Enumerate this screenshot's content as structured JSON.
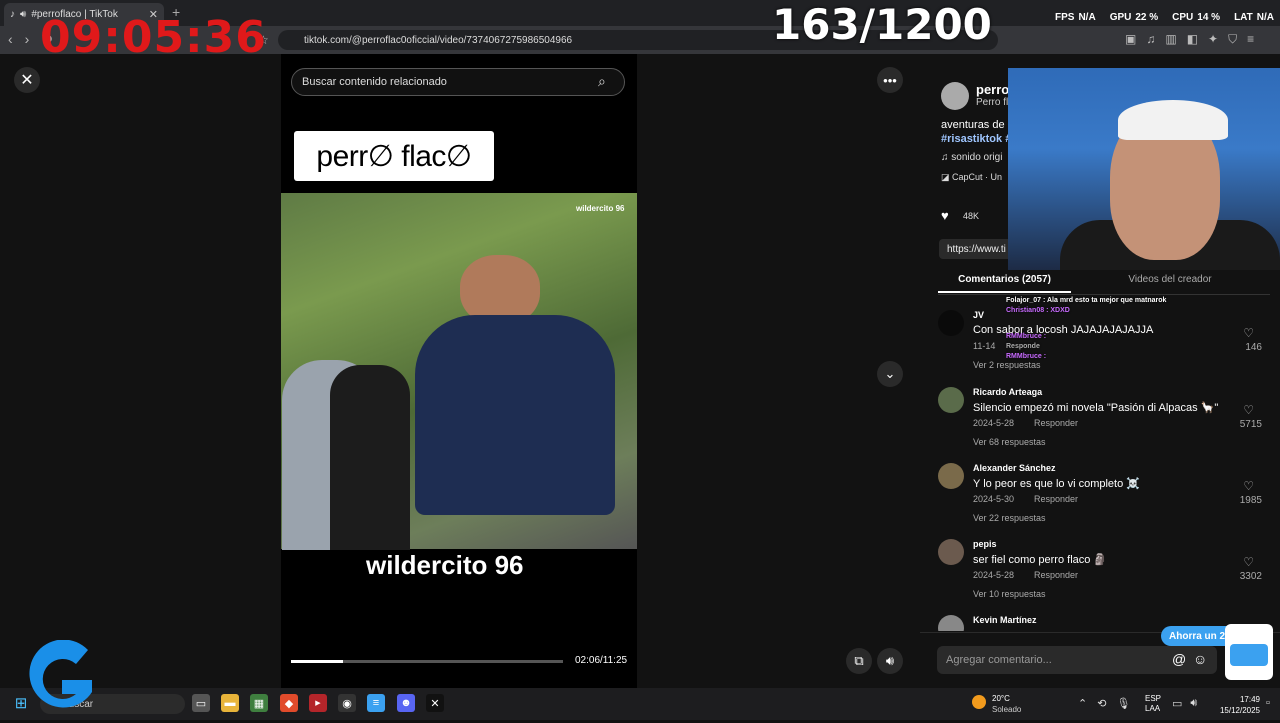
{
  "browser": {
    "tab_title": "#perroflaco | TikTok",
    "tab_close": "✕",
    "new_tab": "+",
    "url": "tiktok.com/@perroflac0oficcial/video/7374067275986504966"
  },
  "overlay": {
    "clock": "09:05:36",
    "counter": "163/1200",
    "fps_label": "FPS",
    "fps_value": "N/A",
    "gpu_label": "GPU",
    "gpu_value": "22 %",
    "cpu_label": "CPU",
    "cpu_value": "14 %",
    "lat_label": "LAT",
    "lat_value": "N/A"
  },
  "video": {
    "search_placeholder": "Buscar contenido relacionado",
    "logo_text": "perr∅ flac∅",
    "watermark": "wildercito 96",
    "caption": "wildercito 96",
    "time": "02:06/11:25",
    "progress": 0.19
  },
  "panel": {
    "author": "perro",
    "author_sub": "Perro fl",
    "desc": "aventuras de",
    "hashtag": "#risastiktok #",
    "sound": "sonido origi",
    "capcut": "CapCut · Un",
    "likes": "48K",
    "link": "https://www.ti",
    "tab_comments": "Comentarios (2057)",
    "tab_videos": "Videos del creador",
    "chat_lines": [
      "Folajor_07 : Ala mrd esto ta mejor que matnarok",
      "Christian08 : XDXD",
      "RMMbruce :",
      "Responde",
      "RMMbruce :"
    ]
  },
  "comments": [
    {
      "user": "JV",
      "text": "Con sabor a locosh JAJAJAJAJAJJA",
      "date": "11-14",
      "reply": "",
      "replies": "Ver 2 respuestas",
      "likes": "146"
    },
    {
      "user": "Ricardo Arteaga",
      "text": "Silencio empezó mi novela \"Pasión di Alpacas 🦙\"",
      "date": "2024-5-28",
      "reply": "Responder",
      "replies": "Ver 68 respuestas",
      "likes": "5715"
    },
    {
      "user": "Alexander Sánchez",
      "text": "Y lo peor es que lo vi completo ☠️",
      "date": "2024-5-30",
      "reply": "Responder",
      "replies": "Ver 22 respuestas",
      "likes": "1985"
    },
    {
      "user": "pepis",
      "text": "ser fiel como perro flaco 🗿",
      "date": "2024-5-28",
      "reply": "Responder",
      "replies": "Ver 10 respuestas",
      "likes": "3302"
    },
    {
      "user": "Kevin Martínez",
      "text": "",
      "date": "",
      "reply": "",
      "replies": "",
      "likes": ""
    }
  ],
  "comment_input_placeholder": "Agregar comentario...",
  "popup": "Ahorra un 2",
  "taskbar": {
    "search": "Buscar",
    "weather_temp": "20°C",
    "weather_desc": "Soleado",
    "lang1": "ESP",
    "lang2": "LAA",
    "time": "17:49",
    "date": "15/12/2025"
  },
  "colors": {
    "accent_red": "#e0191a",
    "tiktok_blue": "#3ba1f0"
  }
}
